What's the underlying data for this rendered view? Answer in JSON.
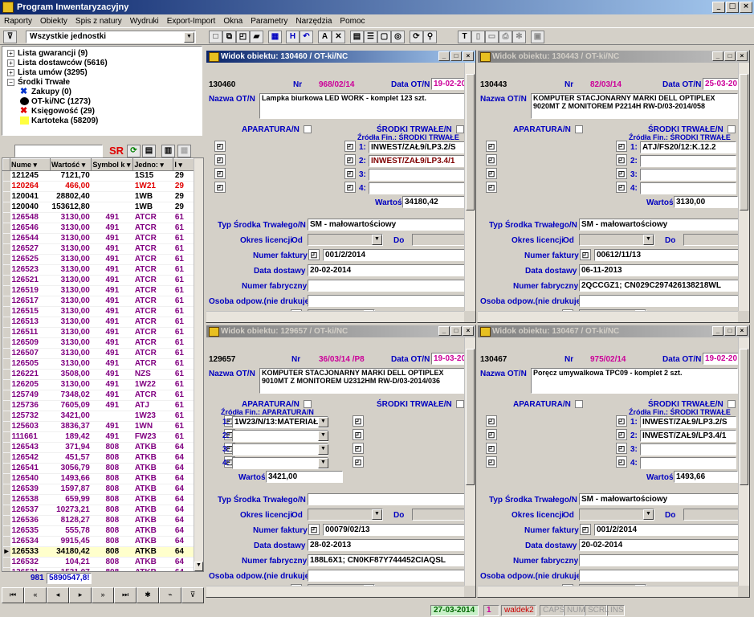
{
  "app": {
    "title": "Program Inwentaryzacyjny"
  },
  "menu": [
    "Raporty",
    "Obiekty",
    "Spis z natury",
    "Wydruki",
    "Export-Import",
    "Okna",
    "Parametry",
    "Narzędzia",
    "Pomoc"
  ],
  "toolbar": {
    "unit_select": "Wszystkie jednostki"
  },
  "tree": {
    "items": [
      {
        "label": "Lista gwarancji (9)",
        "state": "+"
      },
      {
        "label": "Lista dostawców (5616)",
        "state": "+"
      },
      {
        "label": "Lista umów (3295)",
        "state": "+"
      },
      {
        "label": "Środki Trwałe",
        "state": "-"
      },
      {
        "label": "Zakupy (0)",
        "icon": "blue-x-icon"
      },
      {
        "label": "OT-ki/NC (1273)",
        "icon": "black-circle-icon"
      },
      {
        "label": "Księgowość (29)",
        "icon": "red-x-icon"
      },
      {
        "label": "Kartoteka (58209)",
        "icon": "yellow-square-icon"
      }
    ]
  },
  "grid": {
    "sr_label": "SR",
    "columns": [
      "Nume",
      "Wartość",
      "Symbol k",
      "Jedno:",
      "I"
    ],
    "rows": [
      {
        "c": [
          "121245",
          "7121,70",
          "",
          "1S15",
          "29"
        ],
        "color": "#000000"
      },
      {
        "c": [
          "120264",
          "466,00",
          "",
          "1W21",
          "29"
        ],
        "color": "#e00000"
      },
      {
        "c": [
          "120041",
          "28802,40",
          "",
          "1WB",
          "29"
        ],
        "color": "#000000"
      },
      {
        "c": [
          "120040",
          "153612,80",
          "",
          "1WB",
          "29"
        ],
        "color": "#000000"
      },
      {
        "c": [
          "126548",
          "3130,00",
          "491",
          "ATCR",
          "61"
        ],
        "color": "#800080"
      },
      {
        "c": [
          "126546",
          "3130,00",
          "491",
          "ATCR",
          "61"
        ],
        "color": "#800080"
      },
      {
        "c": [
          "126544",
          "3130,00",
          "491",
          "ATCR",
          "61"
        ],
        "color": "#800080"
      },
      {
        "c": [
          "126527",
          "3130,00",
          "491",
          "ATCR",
          "61"
        ],
        "color": "#800080"
      },
      {
        "c": [
          "126525",
          "3130,00",
          "491",
          "ATCR",
          "61"
        ],
        "color": "#800080"
      },
      {
        "c": [
          "126523",
          "3130,00",
          "491",
          "ATCR",
          "61"
        ],
        "color": "#800080"
      },
      {
        "c": [
          "126521",
          "3130,00",
          "491",
          "ATCR",
          "61"
        ],
        "color": "#800080"
      },
      {
        "c": [
          "126519",
          "3130,00",
          "491",
          "ATCR",
          "61"
        ],
        "color": "#800080"
      },
      {
        "c": [
          "126517",
          "3130,00",
          "491",
          "ATCR",
          "61"
        ],
        "color": "#800080"
      },
      {
        "c": [
          "126515",
          "3130,00",
          "491",
          "ATCR",
          "61"
        ],
        "color": "#800080"
      },
      {
        "c": [
          "126513",
          "3130,00",
          "491",
          "ATCR",
          "61"
        ],
        "color": "#800080"
      },
      {
        "c": [
          "126511",
          "3130,00",
          "491",
          "ATCR",
          "61"
        ],
        "color": "#800080"
      },
      {
        "c": [
          "126509",
          "3130,00",
          "491",
          "ATCR",
          "61"
        ],
        "color": "#800080"
      },
      {
        "c": [
          "126507",
          "3130,00",
          "491",
          "ATCR",
          "61"
        ],
        "color": "#800080"
      },
      {
        "c": [
          "126505",
          "3130,00",
          "491",
          "ATCR",
          "61"
        ],
        "color": "#800080"
      },
      {
        "c": [
          "126221",
          "3508,00",
          "491",
          "NZS",
          "61"
        ],
        "color": "#800080"
      },
      {
        "c": [
          "126205",
          "3130,00",
          "491",
          "1W22",
          "61"
        ],
        "color": "#800080"
      },
      {
        "c": [
          "125749",
          "7348,02",
          "491",
          "ATCR",
          "61"
        ],
        "color": "#800080"
      },
      {
        "c": [
          "125736",
          "7605,09",
          "491",
          "ATJ",
          "61"
        ],
        "color": "#800080"
      },
      {
        "c": [
          "125732",
          "3421,00",
          "",
          "1W23",
          "61"
        ],
        "color": "#800080"
      },
      {
        "c": [
          "125603",
          "3836,37",
          "491",
          "1WN",
          "61"
        ],
        "color": "#800080"
      },
      {
        "c": [
          "111661",
          "189,42",
          "491",
          "FW23",
          "61"
        ],
        "color": "#800080"
      },
      {
        "c": [
          "126543",
          "371,94",
          "808",
          "ATKB",
          "64"
        ],
        "color": "#800080"
      },
      {
        "c": [
          "126542",
          "451,57",
          "808",
          "ATKB",
          "64"
        ],
        "color": "#800080"
      },
      {
        "c": [
          "126541",
          "3056,79",
          "808",
          "ATKB",
          "64"
        ],
        "color": "#800080"
      },
      {
        "c": [
          "126540",
          "1493,66",
          "808",
          "ATKB",
          "64"
        ],
        "color": "#800080"
      },
      {
        "c": [
          "126539",
          "1597,87",
          "808",
          "ATKB",
          "64"
        ],
        "color": "#800080"
      },
      {
        "c": [
          "126538",
          "659,99",
          "808",
          "ATKB",
          "64"
        ],
        "color": "#800080"
      },
      {
        "c": [
          "126537",
          "10273,21",
          "808",
          "ATKB",
          "64"
        ],
        "color": "#800080"
      },
      {
        "c": [
          "126536",
          "8128,27",
          "808",
          "ATKB",
          "64"
        ],
        "color": "#800080"
      },
      {
        "c": [
          "126535",
          "555,78",
          "808",
          "ATKB",
          "64"
        ],
        "color": "#800080"
      },
      {
        "c": [
          "126534",
          "9915,45",
          "808",
          "ATKB",
          "64"
        ],
        "color": "#800080"
      },
      {
        "c": [
          "126533",
          "34180,42",
          "808",
          "ATKB",
          "64"
        ],
        "color": "#000000",
        "selected": true
      },
      {
        "c": [
          "126532",
          "104,21",
          "808",
          "ATKB",
          "64"
        ],
        "color": "#800080"
      },
      {
        "c": [
          "126531",
          "1531,07",
          "808",
          "ATKB",
          "64"
        ],
        "color": "#800080"
      }
    ],
    "footer_count": "981",
    "footer_sum": "5890547,8!"
  },
  "labels": {
    "nr": "Nr",
    "data_ot": "Data OT/N",
    "nazwa": "Nazwa OT/N",
    "aparatura": "APARATURA/N",
    "srodki": "ŚRODKI TRWAŁE/N",
    "zrodla_st": "Źródła Fin.: ŚRODKI TRWAŁE",
    "zrodla_ap": "Źródła Fin.: APARATURA/N",
    "wartosc": "Wartość",
    "typ": "Typ Środka Trwałego/N",
    "okres": "Okres licencji",
    "od": "Od",
    "do": "Do",
    "faktura": "Numer faktury",
    "dostawa": "Data dostawy",
    "fabryczny": "Numer fabryczny",
    "osoba": "Osoba odpow.(nie drukuje)",
    "symbol": "Symbol klasyf./Grupa",
    "p1": "1:",
    "p2": "2:",
    "p3": "3:",
    "p4": "4:"
  },
  "windows": [
    {
      "title": "Widok obiektu:  130460 / OT-ki/NC",
      "id": "130460",
      "nr": "968/02/14",
      "nr_extra": "",
      "data": "19-02-20",
      "nazwa": "Lampka biurkowa LED WORK - komplet 123 szt.",
      "fin": [
        "INWEST/ZAŁ9/LP3.2/S",
        "INWEST/ZAŁ9/LP3.4/1",
        "",
        ""
      ],
      "wartosc": "34180,42",
      "typ": "SM - małowartościowy",
      "faktura": "001/2/2014",
      "dostawa": "20-02-2014",
      "fabryczny": "",
      "osoba": "",
      "symbol": "808",
      "side": "st"
    },
    {
      "title": "Widok obiektu:  130443 / OT-ki/NC",
      "id": "130443",
      "nr": "82/03/14",
      "nr_extra": "",
      "data": "25-03-20",
      "nazwa": "KOMPUTER STACJONARNY MARKI DELL OPTIPLEX 9020MT Z MONITOREM P2214H RW-D/03-2014/058",
      "fin": [
        "ATJ/FS20/12:K.12.2",
        "",
        "",
        ""
      ],
      "wartosc": "3130,00",
      "typ": "SM - małowartościowy",
      "faktura": "00612/11/13",
      "dostawa": "06-11-2013",
      "fabryczny": "2QCCGZ1; CN029C297426138218WL",
      "osoba": "",
      "symbol": "491",
      "side": "st"
    },
    {
      "title": "Widok obiektu:  129657 / OT-ki/NC",
      "id": "129657",
      "nr": "36/03/14",
      "nr_extra": "/P8",
      "data": "19-03-20",
      "nazwa": "KOMPUTER STACJONARNY MARKI DELL OPTIPLEX 9010MT Z MONITOREM U2312HM RW-D/03-2014/036",
      "fin": [
        "1W23/N/13:MATERIAŁY",
        "",
        "",
        ""
      ],
      "wartosc": "3421,00",
      "typ": "",
      "faktura": "00079/02/13",
      "dostawa": "28-02-2013",
      "fabryczny": "188L6X1; CN0KF87Y744452CIAQSL",
      "osoba": "",
      "symbol": "",
      "side": "ap"
    },
    {
      "title": "Widok obiektu:  130467 / OT-ki/NC",
      "id": "130467",
      "nr": "975/02/14",
      "nr_extra": "",
      "data": "19-02-20",
      "nazwa": "Poręcz umywalkowa TPC09 - komplet 2 szt.",
      "fin": [
        "INWEST/ZAŁ9/LP3.2/S",
        "INWEST/ZAŁ9/LP3.4/1",
        "",
        ""
      ],
      "wartosc": "1493,66",
      "typ": "SM - małowartościowy",
      "faktura": "001/2/2014",
      "dostawa": "20-02-2014",
      "fabryczny": "",
      "osoba": "",
      "symbol": "808",
      "side": "st"
    }
  ],
  "status": {
    "date": "27-03-2014",
    "num": "1",
    "user": "waldek2",
    "caps": "CAPS",
    "numlock": "NUM",
    "scrl": "SCRL",
    "ins": "INS"
  }
}
